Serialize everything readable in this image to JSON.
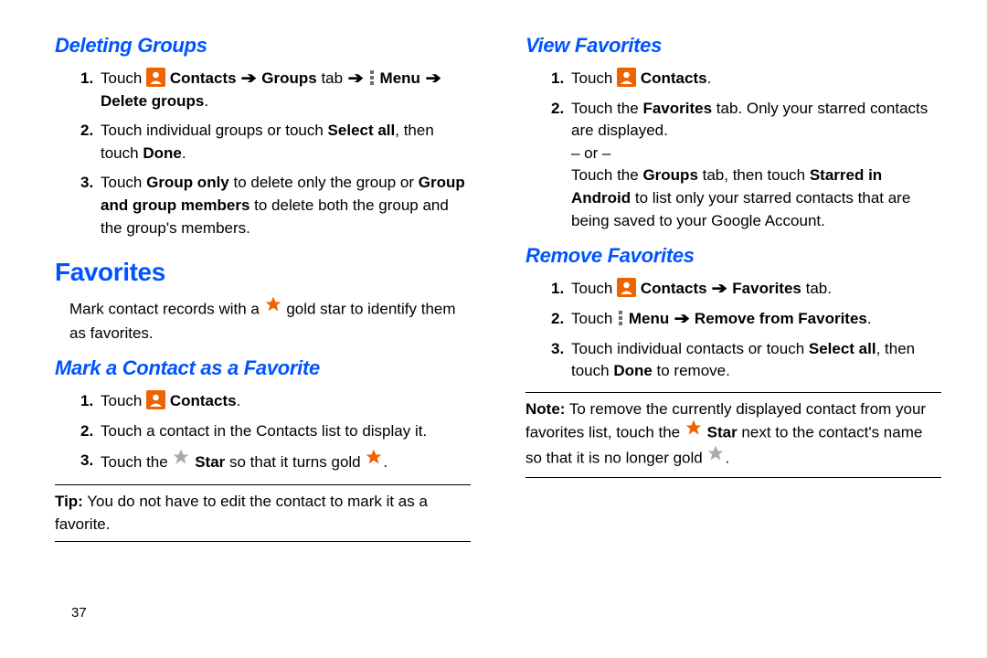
{
  "page_number": "37",
  "left": {
    "h_deleting_groups": "Deleting Groups",
    "dg_step1_a": "Touch ",
    "dg_step1_b": " Contacts ",
    "dg_step1_c": " Groups",
    "dg_step1_d": " tab ",
    "dg_step1_e": " Menu ",
    "dg_step1_f": "Delete groups",
    "dg_step1_g": ".",
    "dg_step2_a": "Touch individual groups or touch ",
    "dg_step2_b": "Select all",
    "dg_step2_c": ", then touch ",
    "dg_step2_d": "Done",
    "dg_step2_e": ".",
    "dg_step3_a": "Touch ",
    "dg_step3_b": "Group only",
    "dg_step3_c": " to delete only the group or ",
    "dg_step3_d": "Group and group members",
    "dg_step3_e": " to delete both the group and the group's members.",
    "h_favorites": "Favorites",
    "fav_body_a": "Mark contact records with a ",
    "fav_body_b": " gold star to identify them as favorites.",
    "h_mark": "Mark a Contact as a Favorite",
    "mk_step1_a": "Touch ",
    "mk_step1_b": " Contacts",
    "mk_step1_c": ".",
    "mk_step2": "Touch a contact in the Contacts list  to display it.",
    "mk_step3_a": "Touch the ",
    "mk_step3_b": " Star",
    "mk_step3_c": " so that it turns gold ",
    "mk_step3_d": ".",
    "tip_label": "Tip:",
    "tip_body": " You do not have to edit the contact to mark it as a favorite."
  },
  "right": {
    "h_view": "View Favorites",
    "vf_step1_a": "Touch ",
    "vf_step1_b": " Contacts",
    "vf_step1_c": ".",
    "vf_step2_a": "Touch the ",
    "vf_step2_b": "Favorites",
    "vf_step2_c": " tab. Only your starred contacts are displayed.",
    "vf_or": "– or –",
    "vf_step2_d": "Touch the ",
    "vf_step2_e": "Groups",
    "vf_step2_f": " tab, then touch ",
    "vf_step2_g": "Starred in Android",
    "vf_step2_h": " to list only your starred contacts that are being saved to your Google Account.",
    "h_remove": "Remove Favorites",
    "rm_step1_a": "Touch ",
    "rm_step1_b": " Contacts ",
    "rm_step1_c": " Favorites",
    "rm_step1_d": " tab.",
    "rm_step2_a": "Touch ",
    "rm_step2_b": " Menu ",
    "rm_step2_c": " Remove from Favorites",
    "rm_step2_d": ".",
    "rm_step3_a": "Touch individual contacts or touch ",
    "rm_step3_b": "Select all",
    "rm_step3_c": ", then touch ",
    "rm_step3_d": "Done",
    "rm_step3_e": " to remove.",
    "note_label": "Note:",
    "note_a": " To remove the currently displayed contact from your favorites list, touch the ",
    "note_b": " Star",
    "note_c": " next to the contact's name so that it is no longer gold ",
    "note_d": "."
  }
}
